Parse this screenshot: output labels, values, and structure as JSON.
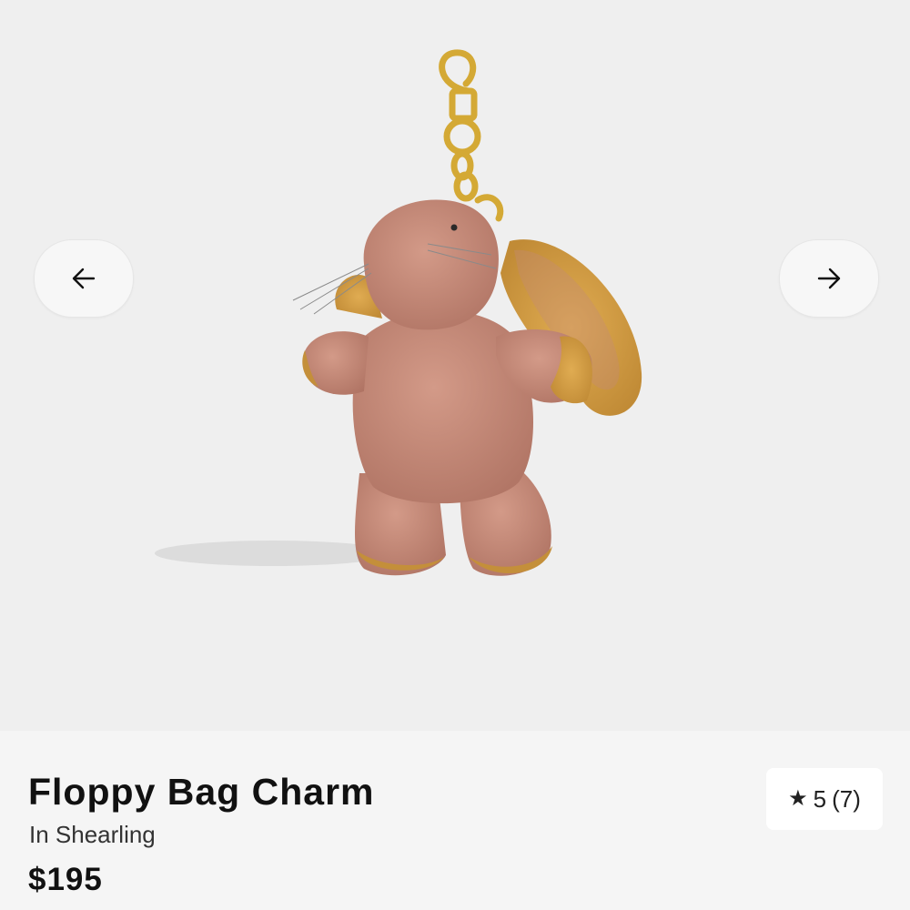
{
  "gallery": {
    "prev_icon": "arrow-left-icon",
    "next_icon": "arrow-right-icon",
    "image_colors": {
      "background": "#efefef",
      "body": "#c48a7a",
      "ear_inner": "#d49f45",
      "hardware": "#d4a935"
    }
  },
  "product": {
    "title": "Floppy Bag Charm",
    "subtitle": "In Shearling",
    "price": "$195"
  },
  "rating": {
    "icon": "star-icon",
    "score": "5",
    "count": "(7)"
  }
}
